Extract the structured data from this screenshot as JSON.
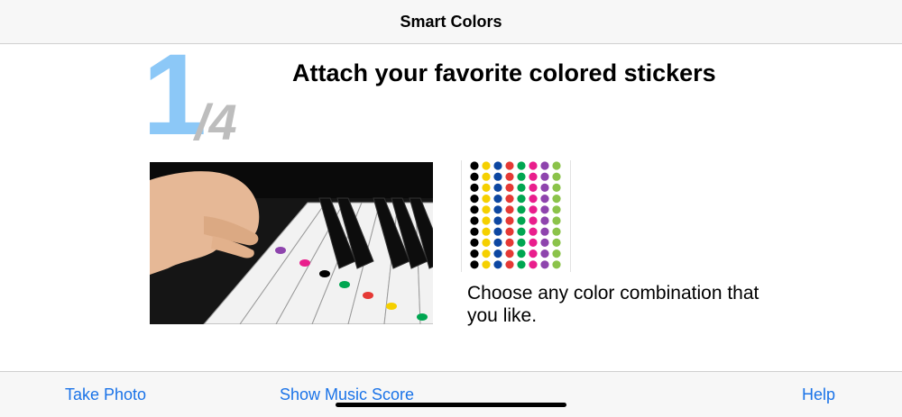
{
  "nav": {
    "title": "Smart Colors"
  },
  "step": {
    "current": "1",
    "total": "/4"
  },
  "headline": "Attach your favorite colored stickers",
  "caption": "Choose any color combination that you like.",
  "sticker_colors": [
    "#000000",
    "#f5d000",
    "#0d47a1",
    "#e53935",
    "#00a651",
    "#e91e8c",
    "#8e44ad",
    "#8bc34a"
  ],
  "toolbar": {
    "take_photo": "Take Photo",
    "show_score": "Show Music Score",
    "help": "Help"
  },
  "colors": {
    "accent": "#1a73e8",
    "step_number": "#8cc8f7"
  }
}
